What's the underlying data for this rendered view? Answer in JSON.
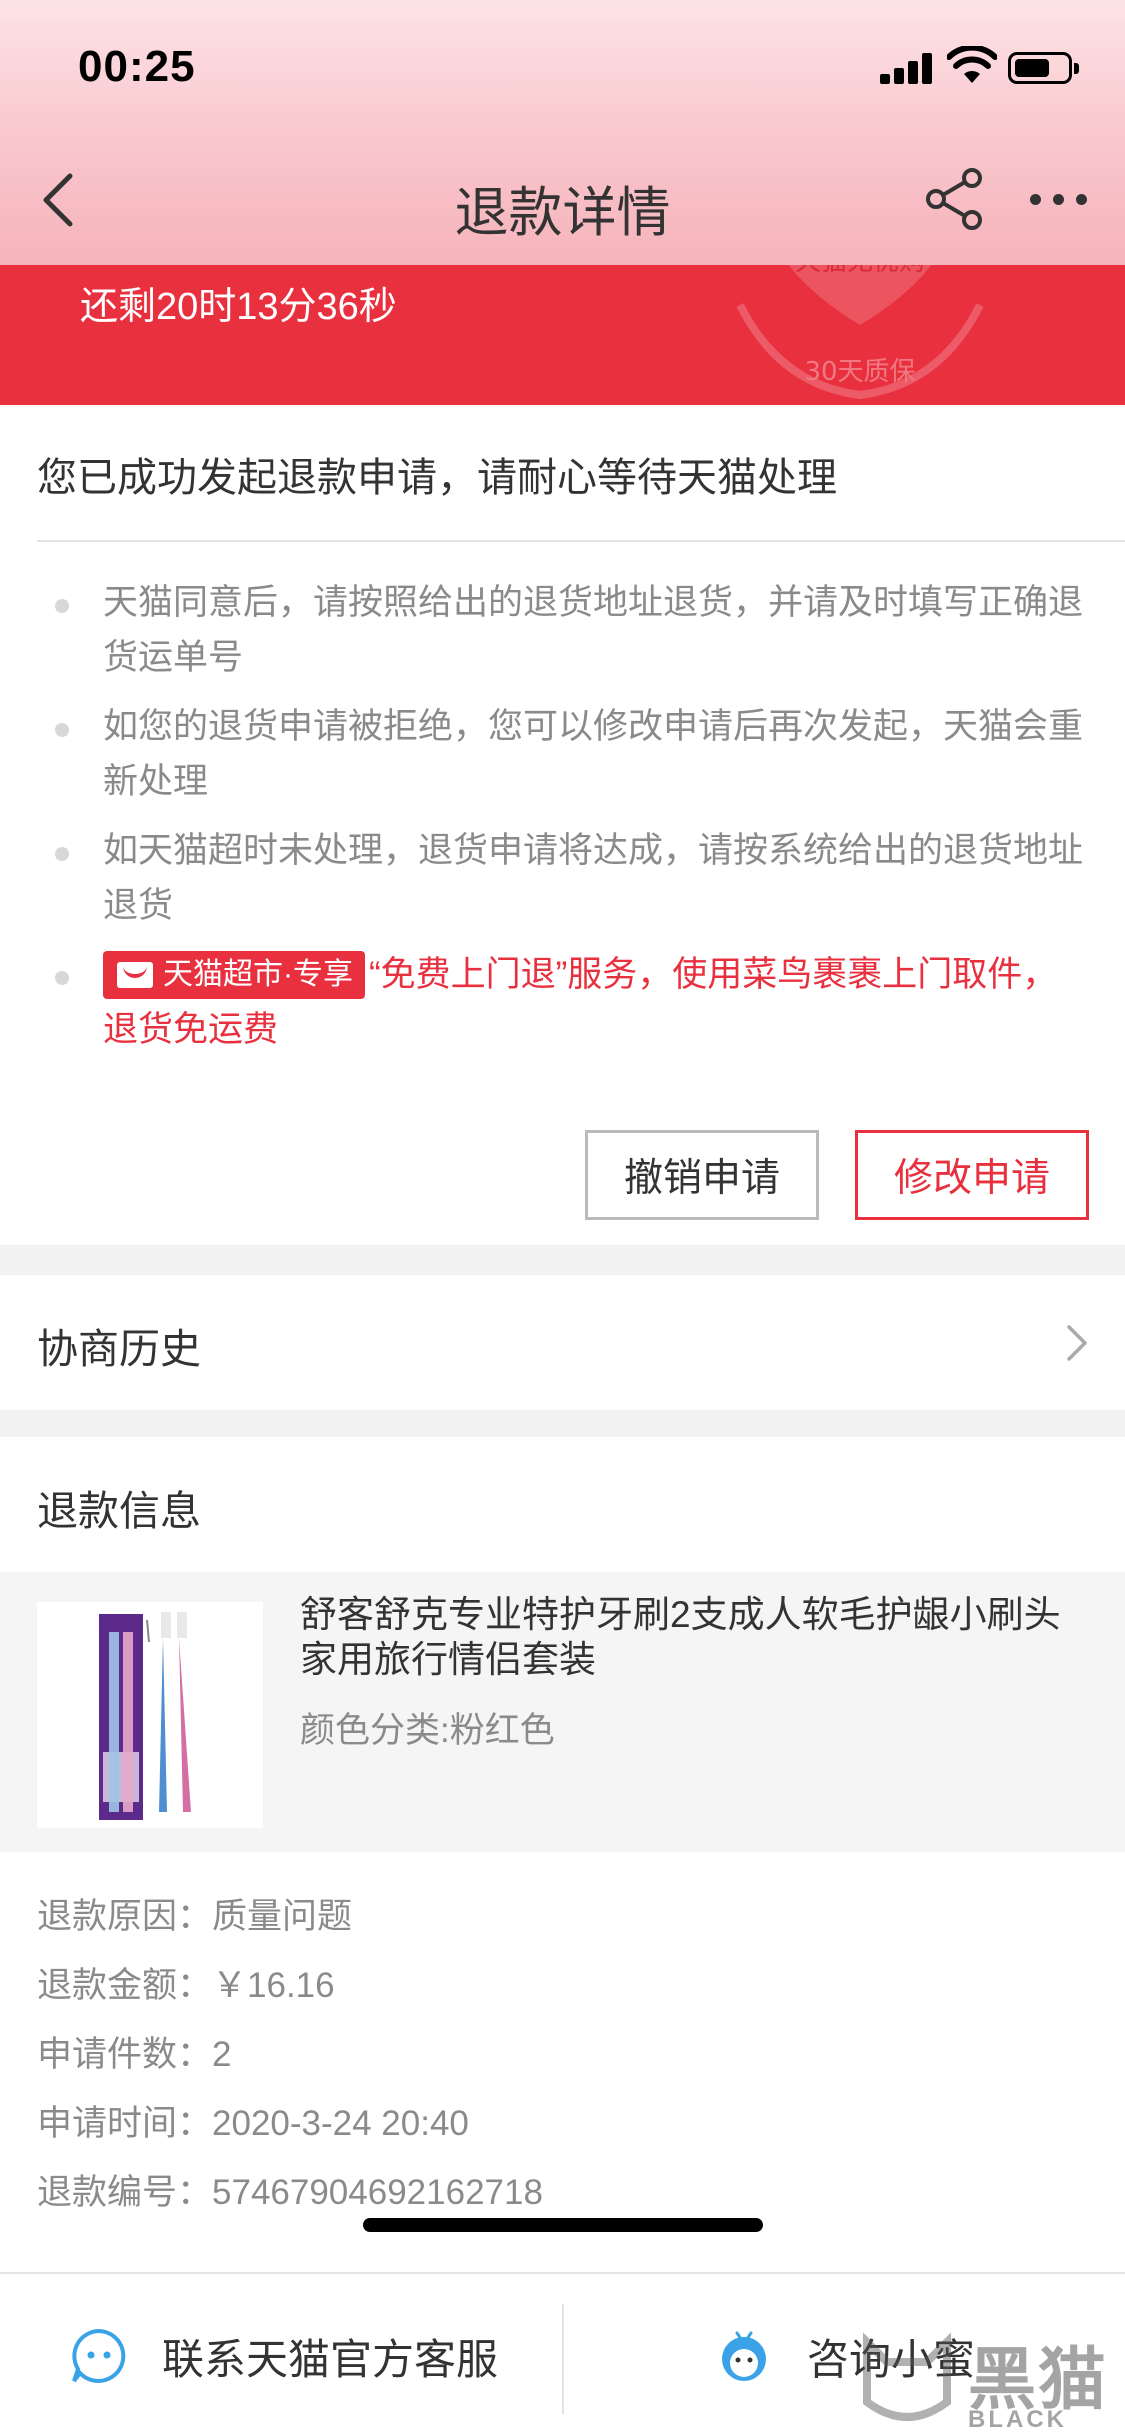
{
  "status_bar": {
    "time": "00:25"
  },
  "nav": {
    "title": "退款详情"
  },
  "banner": {
    "countdown": "还剩20时13分36秒",
    "seal_text": "天猫无忧购",
    "seal_sub": "30天质保"
  },
  "application": {
    "status_message": "您已成功发起退款申请，请耐心等待天猫处理",
    "tips": [
      "天猫同意后，请按照给出的退货地址退货，并请及时填写正确退货运单号",
      "如您的退货申请被拒绝，您可以修改申请后再次发起，天猫会重新处理",
      "如天猫超时未处理，退货申请将达成，请按系统给出的退货地址退货"
    ],
    "promo_badge": "天猫超市·专享",
    "promo_text": "“免费上门退”服务，使用菜鸟裹裹上门取件，退货免运费",
    "cancel_label": "撤销申请",
    "modify_label": "修改申请"
  },
  "history": {
    "label": "协商历史"
  },
  "refund_info": {
    "title": "退款信息",
    "product_name": "舒客舒克专业特护牙刷2支成人软毛护龈小刷头家用旅行情侣套装",
    "product_sku": "颜色分类:粉红色",
    "rows": [
      {
        "label": "退款原因：",
        "value": "质量问题"
      },
      {
        "label": "退款金额：",
        "value": "￥16.16"
      },
      {
        "label": "申请件数：",
        "value": "2"
      },
      {
        "label": "申请时间：",
        "value": "2020-3-24 20:40"
      },
      {
        "label": "退款编号：",
        "value": "57467904692162718"
      }
    ]
  },
  "bottom_bar": {
    "left_label": "联系天猫官方客服",
    "right_label": "咨询小蜜"
  },
  "watermark": {
    "text": "黑猫",
    "sub": "BLACK CAT"
  },
  "colors": {
    "accent": "#e8303f",
    "header_pink": "#f9c6cc",
    "muted": "#8a8a8a"
  }
}
